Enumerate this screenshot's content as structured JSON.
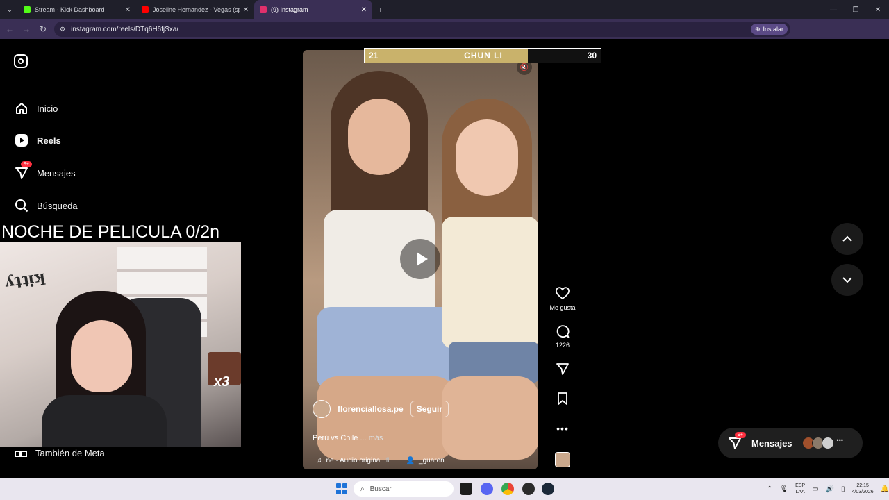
{
  "browser": {
    "tabs": [
      {
        "title": "Stream - Kick Dashboard",
        "color": "#53fc18"
      },
      {
        "title": "Joseline Hernandez - Vegas (sp",
        "color": "#ff0000"
      },
      {
        "title": "(9) Instagram",
        "color": "#e1306c"
      }
    ],
    "url": "instagram.com/reels/DTq6H6fjSxa/",
    "install_label": "Instalar"
  },
  "sidebar": {
    "items": [
      {
        "label": "Inicio",
        "icon": "home-icon"
      },
      {
        "label": "Reels",
        "icon": "reels-icon"
      },
      {
        "label": "Mensajes",
        "icon": "messages-icon",
        "badge": "9+"
      },
      {
        "label": "Búsqueda",
        "icon": "search-icon"
      }
    ],
    "also_meta": "También de Meta"
  },
  "stream_overlay": {
    "title": "NOCHE DE PELICULA 0/2n",
    "emote_counter": "x3"
  },
  "reel": {
    "username": "florenciallosa.pe",
    "follow_label": "Seguir",
    "caption": "Perú vs Chile",
    "more_label": "... más",
    "audio": "ne · Audio original",
    "audio_tag": "fl",
    "tagged_user": "_guaren"
  },
  "game_bar": {
    "left_value": "21",
    "name": "CHUN LI",
    "right_value": "30",
    "fill_fraction": 0.69
  },
  "actions": {
    "like_label": "Me gusta",
    "comments_count": "1226"
  },
  "messages_pill": {
    "label": "Mensajes",
    "badge": "9+"
  },
  "taskbar": {
    "search_placeholder": "Buscar",
    "lang_top": "ESP",
    "lang_bottom": "LAA",
    "time": "22:15",
    "date": "4/03/2026"
  }
}
